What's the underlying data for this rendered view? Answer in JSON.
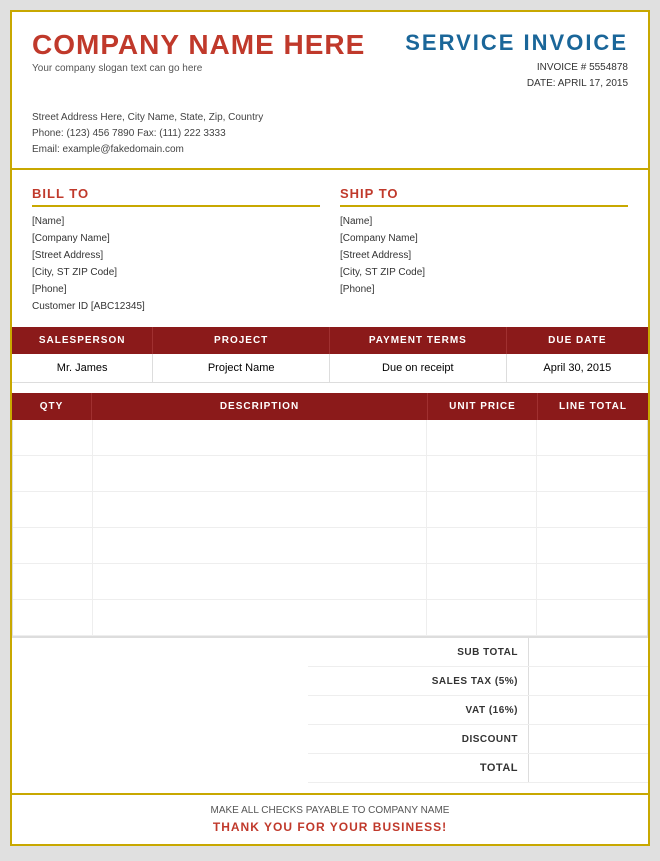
{
  "header": {
    "company_name": "COMPANY NAME HERE",
    "company_slogan": "Your company slogan text can go here",
    "invoice_title": "SERVICE  INVOICE",
    "invoice_number_label": "INVOICE #",
    "invoice_number": "5554878",
    "date_label": "DATE:",
    "date_value": "APRIL 17, 2015"
  },
  "address": {
    "street": "Street Address Here, City Name, State, Zip, Country",
    "phone_fax": "Phone: (123) 456 7890 Fax:  (111) 222 3333",
    "email": "Email: example@fakedomain.com"
  },
  "bill_to": {
    "label": "BILL TO",
    "lines": [
      "[Name]",
      "[Company Name]",
      "[Street Address]",
      "[City, ST  ZIP Code]",
      "[Phone]",
      "Customer ID [ABC12345]"
    ]
  },
  "ship_to": {
    "label": "SHIP TO",
    "lines": [
      "[Name]",
      "[Company Name]",
      "[Street Address]",
      "[City, ST  ZIP Code]",
      "[Phone]"
    ]
  },
  "payment_table": {
    "headers": [
      "SALESPERSON",
      "PROJECT",
      "PAYMENT TERMS",
      "DUE DATE"
    ],
    "row": {
      "salesperson": "Mr. James",
      "project": "Project Name",
      "payment_terms": "Due on receipt",
      "due_date": "April 30, 2015"
    }
  },
  "items_table": {
    "headers": [
      "QTY",
      "DESCRIPTION",
      "UNIT PRICE",
      "LINE TOTAL"
    ],
    "rows": [
      {
        "qty": "",
        "description": "",
        "unit_price": "",
        "line_total": ""
      },
      {
        "qty": "",
        "description": "",
        "unit_price": "",
        "line_total": ""
      },
      {
        "qty": "",
        "description": "",
        "unit_price": "",
        "line_total": ""
      },
      {
        "qty": "",
        "description": "",
        "unit_price": "",
        "line_total": ""
      },
      {
        "qty": "",
        "description": "",
        "unit_price": "",
        "line_total": ""
      },
      {
        "qty": "",
        "description": "",
        "unit_price": "",
        "line_total": ""
      }
    ]
  },
  "totals": {
    "sub_total_label": "SUB TOTAL",
    "sales_tax_label": "SALES TAX (5%)",
    "vat_label": "VAT (16%)",
    "discount_label": "DISCOUNT",
    "total_label": "TOTAL",
    "sub_total_value": "",
    "sales_tax_value": "",
    "vat_value": "",
    "discount_value": "",
    "total_value": ""
  },
  "footer": {
    "line1": "MAKE ALL CHECKS PAYABLE TO COMPANY NAME",
    "line2": "THANK YOU FOR YOUR BUSINESS!"
  }
}
